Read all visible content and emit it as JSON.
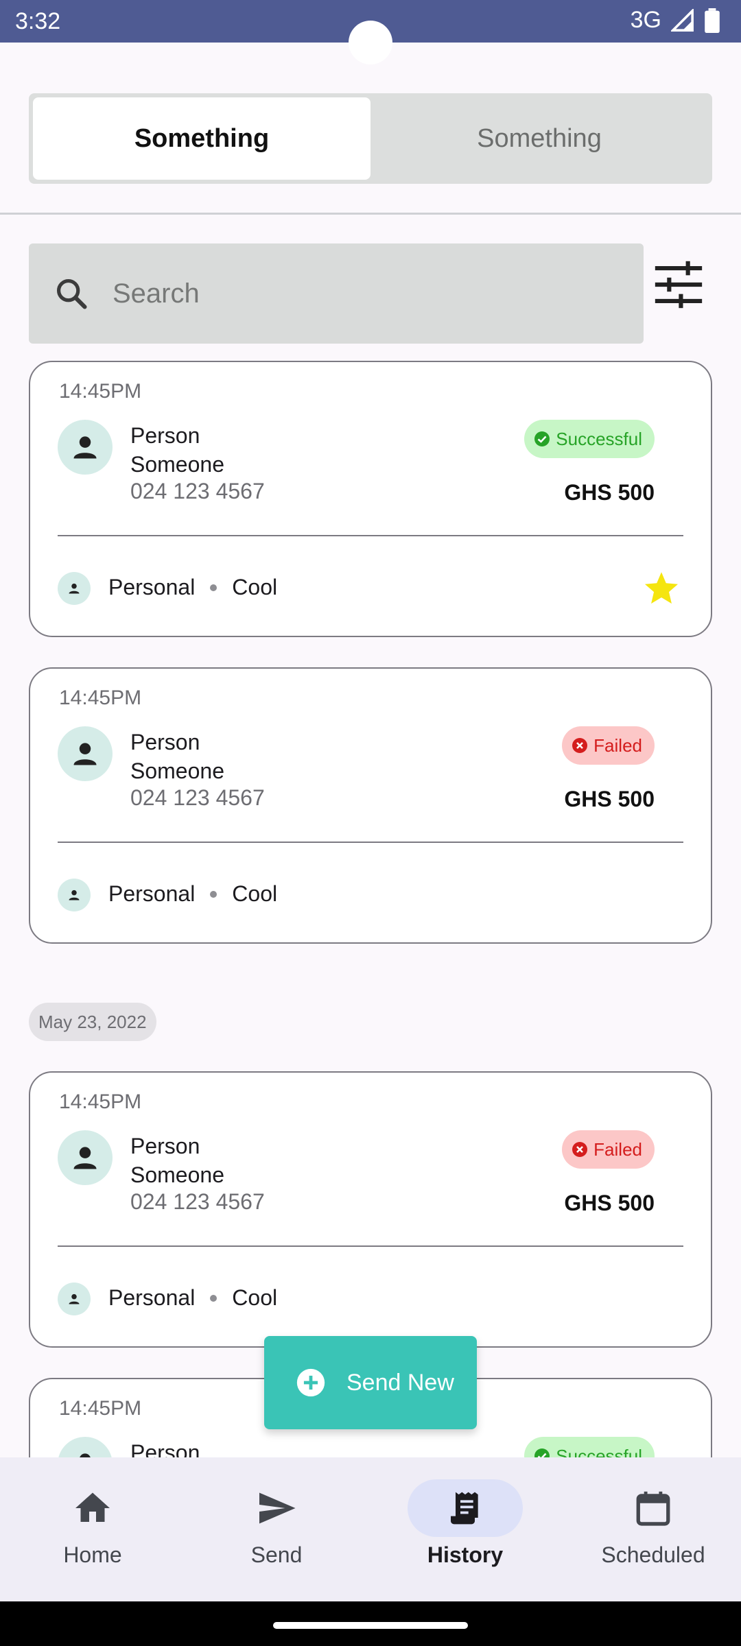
{
  "status_bar": {
    "time": "3:32",
    "network": "3G"
  },
  "tabs": [
    {
      "label": "Something",
      "active": true
    },
    {
      "label": "Something",
      "active": false
    }
  ],
  "search": {
    "placeholder": "Search",
    "value": ""
  },
  "transactions": [
    {
      "time": "14:45PM",
      "first_name": "Person",
      "last_name": "Someone",
      "phone": "024 123 4567",
      "status": "Successful",
      "amount": "GHS 500",
      "category": "Personal",
      "tag": "Cool",
      "starred": true
    },
    {
      "time": "14:45PM",
      "first_name": "Person",
      "last_name": "Someone",
      "phone": "024 123 4567",
      "status": "Failed",
      "amount": "GHS 500",
      "category": "Personal",
      "tag": "Cool",
      "starred": false
    },
    {
      "time": "14:45PM",
      "first_name": "Person",
      "last_name": "Someone",
      "phone": "024 123 4567",
      "status": "Failed",
      "amount": "GHS 500",
      "category": "Personal",
      "tag": "Cool",
      "starred": false
    },
    {
      "time": "14:45PM",
      "first_name": "Person",
      "status": "Successful"
    }
  ],
  "date_separator": "May 23, 2022",
  "fab": {
    "label": "Send New"
  },
  "nav": [
    {
      "label": "Home",
      "icon": "home-icon",
      "active": false
    },
    {
      "label": "Send",
      "icon": "send-icon",
      "active": false
    },
    {
      "label": "History",
      "icon": "receipt-icon",
      "active": true
    },
    {
      "label": "Scheduled",
      "icon": "calendar-icon",
      "active": false
    }
  ],
  "colors": {
    "status_bar": "#4f5b93",
    "accent": "#3ac4b6",
    "success_bg": "#c7f6c6",
    "success_fg": "#27a327",
    "fail_bg": "#fcc7c7",
    "fail_fg": "#d41d1d",
    "star": "#f5e50f",
    "nav_active_pill": "#dde1f8"
  }
}
